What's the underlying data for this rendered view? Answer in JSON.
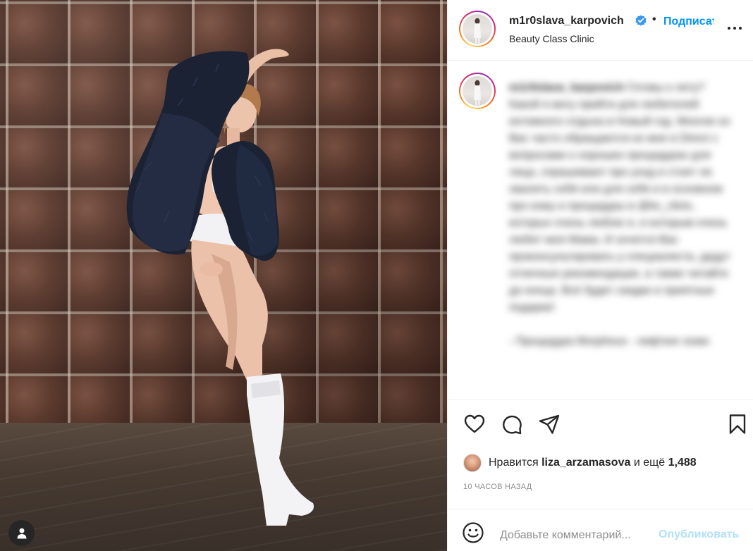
{
  "post": {
    "username": "m1r0slava_karpovich",
    "verified": true,
    "separator": "•",
    "follow_label": "Подписаться",
    "location": "Beauty Class Clinic",
    "more_icon": "more-options-icon"
  },
  "caption": {
    "username": "m1r0slava_karpovich",
    "paragraphs": [
      "Готовы к лету? Какой я могу прийти для любителей интимного отдыха в Новый год. Многие из Вас часто обращаются ко мне в Direct с вопросами о хороших процедурах для лица, спрашивают про уход и стоит ли хвалить себя или для себя и в основном про кожу и процедуры в @bc_clinic, которых очень люблю я, и которым очень любит моя Мама. И хочется Вас проконсультировать у специалиста, дадут отличные рекомендации, а также читайте до конца. Всё будет скидки и приятные подарки!",
      "- Процедура Morpheus - лифтинг кожи"
    ]
  },
  "actions": {
    "like_icon": "heart-icon",
    "comment_icon": "comment-icon",
    "share_icon": "share-icon",
    "save_icon": "bookmark-icon"
  },
  "likes": {
    "prefix": "Нравится",
    "user": "liza_arzamasova",
    "middle": "и ещё",
    "count": "1,488"
  },
  "timestamp": "10 часов назад",
  "comment": {
    "placeholder": "Добавьте комментарий...",
    "publish_label": "Опубликовать"
  }
}
